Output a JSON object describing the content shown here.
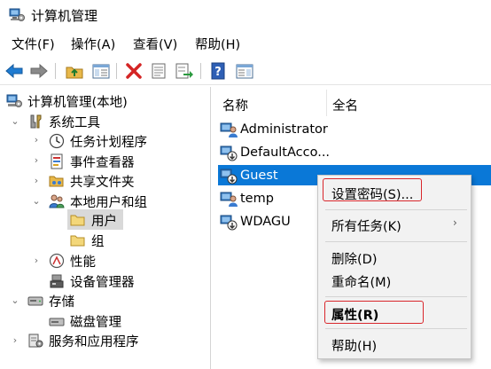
{
  "window": {
    "title": "计算机管理"
  },
  "menubar": [
    {
      "label": "文件(F)"
    },
    {
      "label": "操作(A)"
    },
    {
      "label": "查看(V)"
    },
    {
      "label": "帮助(H)"
    }
  ],
  "toolbar": [
    {
      "icon": "back-arrow-icon"
    },
    {
      "icon": "forward-arrow-icon"
    },
    {
      "icon": "up-folder-icon"
    },
    {
      "icon": "show-hide-console-tree-icon"
    },
    {
      "icon": "delete-icon"
    },
    {
      "icon": "properties-icon"
    },
    {
      "icon": "export-list-icon"
    },
    {
      "icon": "help-icon"
    },
    {
      "icon": "show-action-pane-icon"
    }
  ],
  "tree": [
    {
      "label": "计算机管理(本地)",
      "icon": "computer-management-icon",
      "expanded": true
    },
    {
      "label": "系统工具",
      "icon": "system-tools-icon",
      "expanded": true
    },
    {
      "label": "任务计划程序",
      "icon": "clock-icon",
      "expanded": false
    },
    {
      "label": "事件查看器",
      "icon": "event-viewer-icon",
      "expanded": false
    },
    {
      "label": "共享文件夹",
      "icon": "shared-folder-icon",
      "expanded": false
    },
    {
      "label": "本地用户和组",
      "icon": "users-groups-icon",
      "expanded": true
    },
    {
      "label": "用户",
      "icon": "folder-icon",
      "selected": true
    },
    {
      "label": "组",
      "icon": "folder-icon"
    },
    {
      "label": "性能",
      "icon": "performance-icon",
      "expanded": false
    },
    {
      "label": "设备管理器",
      "icon": "device-manager-icon"
    },
    {
      "label": "存储",
      "icon": "storage-icon",
      "expanded": true
    },
    {
      "label": "磁盘管理",
      "icon": "disk-management-icon"
    },
    {
      "label": "服务和应用程序",
      "icon": "services-icon",
      "expanded": false
    }
  ],
  "list": {
    "columns": [
      "名称",
      "全名"
    ],
    "rows": [
      {
        "name": "Administrator",
        "disabled": false
      },
      {
        "name": "DefaultAcco...",
        "disabled": true
      },
      {
        "name": "Guest",
        "disabled": true,
        "selected": true
      },
      {
        "name": "temp",
        "disabled": false
      },
      {
        "name": "WDAGU",
        "disabled": true
      }
    ]
  },
  "context_menu": {
    "items": [
      {
        "label": "设置密码(S)...",
        "highlighted": true
      },
      {
        "label": "所有任务(K)",
        "submenu": true
      },
      {
        "label": "删除(D)"
      },
      {
        "label": "重命名(M)"
      },
      {
        "label": "属性(R)",
        "bold": true,
        "highlighted": true
      },
      {
        "label": "帮助(H)"
      }
    ],
    "submenu_arrow": "›"
  },
  "colors": {
    "selection_blue": "#0a78d7",
    "tree_selection": "#d9d9d9",
    "menu_bg": "#f2f2f2",
    "highlight_box": "#d9262b"
  }
}
